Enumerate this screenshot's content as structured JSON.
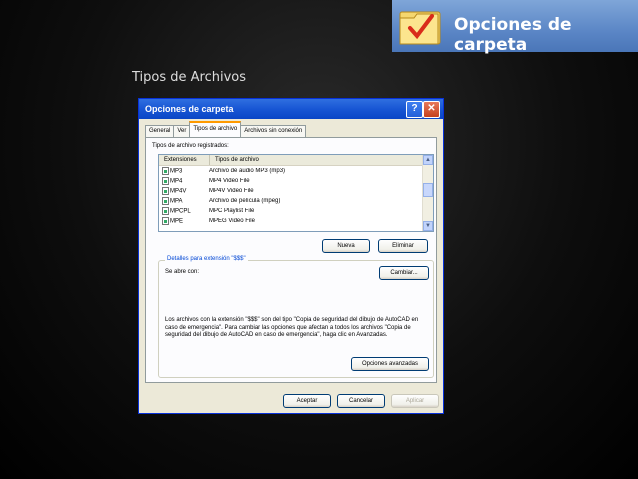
{
  "slide": {
    "banner_title": "Opciones de carpeta",
    "subtitle": "Tipos de Archivos"
  },
  "dialog": {
    "title": "Opciones de carpeta",
    "help_symbol": "?",
    "close_symbol": "✕",
    "tabs": [
      "General",
      "Ver",
      "Tipos de archivo",
      "Archivos sin conexión"
    ],
    "active_tab": "Tipos de archivo",
    "registered_label": "Tipos de archivo registrados:",
    "columns": [
      "Extensiones",
      "Tipos de archivo"
    ],
    "rows": [
      {
        "ext": "MP3",
        "type": "Archivo de audio MP3 (mp3)"
      },
      {
        "ext": "MP4",
        "type": "MP4 Video File"
      },
      {
        "ext": "MP4V",
        "type": "MP4V Video File"
      },
      {
        "ext": "MPA",
        "type": "Archivo de película (mpeg)"
      },
      {
        "ext": "MPCPL",
        "type": "MPC Playlist File"
      },
      {
        "ext": "MPE",
        "type": "MPEG Video File"
      }
    ],
    "new_button": "Nueva",
    "delete_button": "Eliminar",
    "details_legend": "Detalles para extensión \"$$$\"",
    "opens_with_label": "Se abre con:",
    "change_button": "Cambiar...",
    "description": "Los archivos con la extensión \"$$$\" son del tipo \"Copia de seguridad del dibujo de AutoCAD en caso de emergencia\". Para cambiar las opciones que afectan a todos los archivos \"Copia de seguridad del dibujo de AutoCAD en caso de emergencia\", haga clic en Avanzadas.",
    "advanced_button": "Opciones avanzadas",
    "ok_button": "Aceptar",
    "cancel_button": "Cancelar",
    "apply_button": "Aplicar"
  }
}
